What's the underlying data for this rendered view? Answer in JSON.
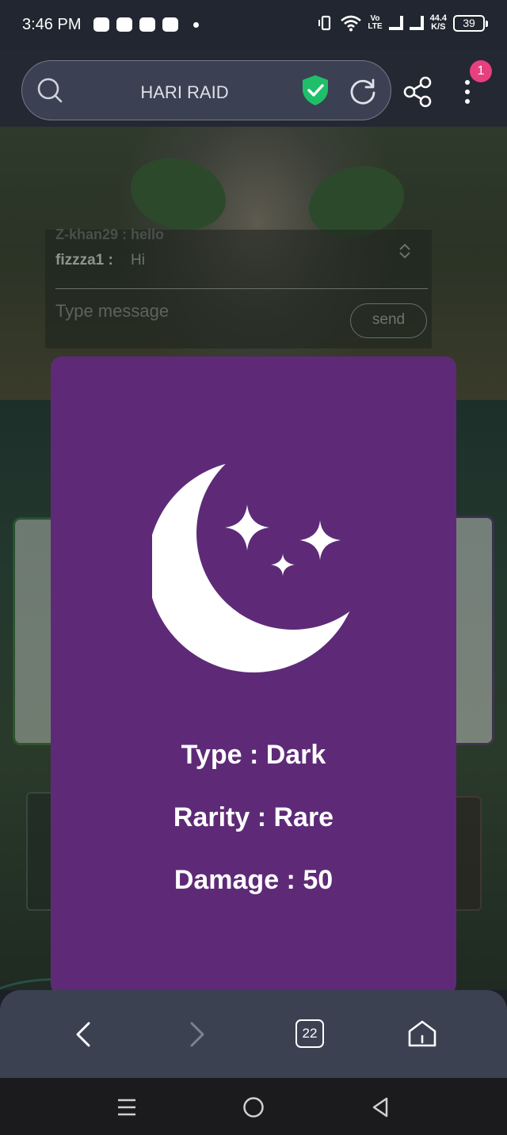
{
  "status_bar": {
    "time": "3:46 PM",
    "volte_label": "Vo\nLTE",
    "net_speed": "44.4\nK/S",
    "battery": "39"
  },
  "browser": {
    "url_title": "HARI RAID",
    "notification_count": "1",
    "tab_count": "22",
    "icons": [
      "search-icon",
      "shield-check-icon",
      "reload-icon",
      "share-icon",
      "menu-icon",
      "back-icon",
      "forward-icon",
      "tabs-icon",
      "home-icon"
    ],
    "shield_color": "#1fbf6a"
  },
  "chat": {
    "faded_line": "Z-khan29 : hello",
    "user": "fizzza1 :",
    "message": "Hi",
    "input_placeholder": "Type message",
    "send_label": "send"
  },
  "modal": {
    "icon": "moon-stars-icon",
    "background_color": "#5e2a77",
    "type_line": "Type : Dark",
    "rarity_line": "Rarity : Rare",
    "damage_line": "Damage : 50"
  },
  "system_nav": {
    "icons": [
      "recents-icon",
      "home-circle-icon",
      "back-triangle-icon"
    ]
  }
}
